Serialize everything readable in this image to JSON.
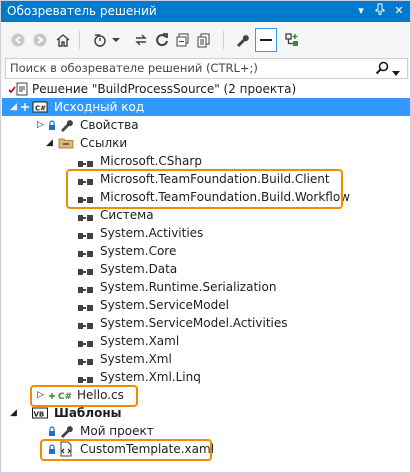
{
  "window": {
    "title": "Обозреватель решений",
    "title_buttons": [
      "▾",
      "⊢",
      "✕"
    ]
  },
  "search": {
    "placeholder": "Поиск в обозревателе решений (CTRL+;)"
  },
  "tree": {
    "solution": "Решение \"BuildProcessSource\" (2 проекта)",
    "project1": "Исходный код",
    "properties": "Свойства",
    "references": "Ссылки",
    "refs": [
      "Microsoft.CSharp",
      "Microsoft.TeamFoundation.Build.Client",
      "Microsoft.TeamFoundation.Build.Workflow",
      "Система",
      "System.Activities",
      "System.Core",
      "System.Data",
      "System.Runtime.Serialization",
      "System.ServiceModel",
      "System.ServiceModel.Activities",
      "System.Xaml",
      "System.Xml",
      "System.Xml.Linq"
    ],
    "hello": "Hello.cs",
    "project2": "Шаблоны",
    "my_project": "Мой проект",
    "custom_template": "CustomTemplate.xaml"
  },
  "colors": {
    "accent": "#007acc",
    "selection": "#3399ff",
    "highlight": "#f08c00"
  }
}
